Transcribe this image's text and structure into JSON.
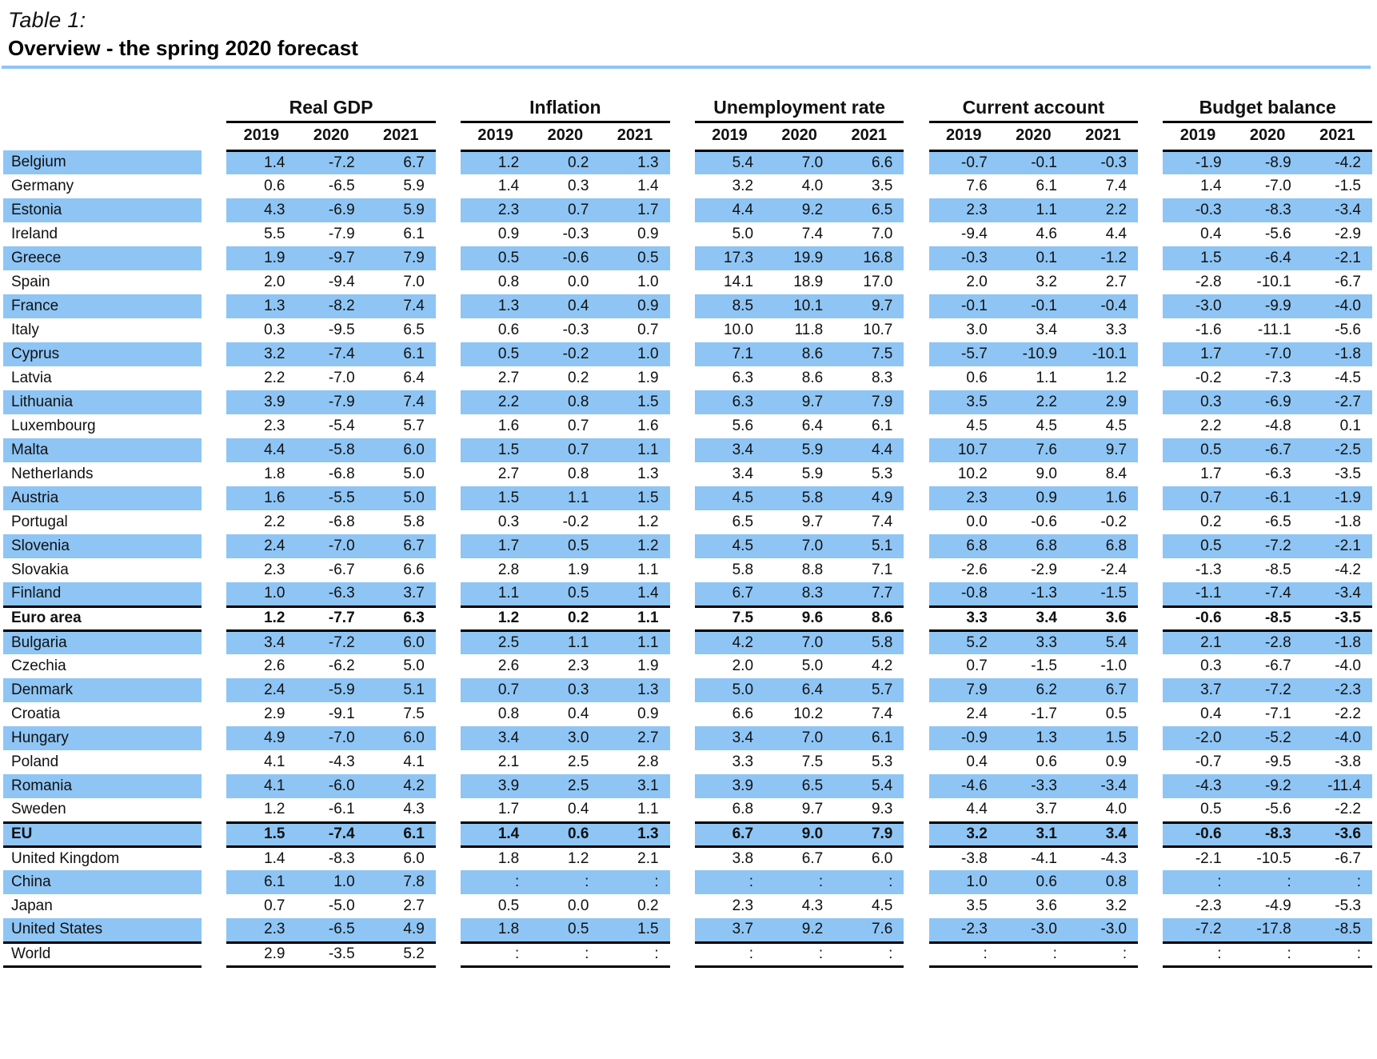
{
  "header": {
    "table_label": "Table 1:",
    "title": "Overview - the spring 2020 forecast",
    "accent_color": "#8EC5F5"
  },
  "columns": {
    "groups": [
      "Real GDP",
      "Inflation",
      "Unemployment rate",
      "Current account",
      "Budget balance"
    ],
    "years": [
      "2019",
      "2020",
      "2021"
    ],
    "missing_symbol": ":"
  },
  "chart_data": {
    "type": "table",
    "title": "Overview - the spring 2020 forecast",
    "column_groups": [
      "Real GDP",
      "Inflation",
      "Unemployment rate",
      "Current account",
      "Budget balance"
    ],
    "years": [
      "2019",
      "2020",
      "2021"
    ],
    "row_labels": [
      "Belgium",
      "Germany",
      "Estonia",
      "Ireland",
      "Greece",
      "Spain",
      "France",
      "Italy",
      "Cyprus",
      "Latvia",
      "Lithuania",
      "Luxembourg",
      "Malta",
      "Netherlands",
      "Austria",
      "Portugal",
      "Slovenia",
      "Slovakia",
      "Finland",
      "Euro area",
      "Bulgaria",
      "Czechia",
      "Denmark",
      "Croatia",
      "Hungary",
      "Poland",
      "Romania",
      "Sweden",
      "EU",
      "United Kingdom",
      "China",
      "Japan",
      "United States",
      "World"
    ]
  },
  "rows": [
    {
      "name": "Belgium",
      "shade": true,
      "agg": false,
      "gdp": [
        "1.4",
        "-7.2",
        "6.7"
      ],
      "inf": [
        "1.2",
        "0.2",
        "1.3"
      ],
      "unemp": [
        "5.4",
        "7.0",
        "6.6"
      ],
      "ca": [
        "-0.7",
        "-0.1",
        "-0.3"
      ],
      "bud": [
        "-1.9",
        "-8.9",
        "-4.2"
      ]
    },
    {
      "name": "Germany",
      "shade": false,
      "agg": false,
      "gdp": [
        "0.6",
        "-6.5",
        "5.9"
      ],
      "inf": [
        "1.4",
        "0.3",
        "1.4"
      ],
      "unemp": [
        "3.2",
        "4.0",
        "3.5"
      ],
      "ca": [
        "7.6",
        "6.1",
        "7.4"
      ],
      "bud": [
        "1.4",
        "-7.0",
        "-1.5"
      ]
    },
    {
      "name": "Estonia",
      "shade": true,
      "agg": false,
      "gdp": [
        "4.3",
        "-6.9",
        "5.9"
      ],
      "inf": [
        "2.3",
        "0.7",
        "1.7"
      ],
      "unemp": [
        "4.4",
        "9.2",
        "6.5"
      ],
      "ca": [
        "2.3",
        "1.1",
        "2.2"
      ],
      "bud": [
        "-0.3",
        "-8.3",
        "-3.4"
      ]
    },
    {
      "name": "Ireland",
      "shade": false,
      "agg": false,
      "gdp": [
        "5.5",
        "-7.9",
        "6.1"
      ],
      "inf": [
        "0.9",
        "-0.3",
        "0.9"
      ],
      "unemp": [
        "5.0",
        "7.4",
        "7.0"
      ],
      "ca": [
        "-9.4",
        "4.6",
        "4.4"
      ],
      "bud": [
        "0.4",
        "-5.6",
        "-2.9"
      ]
    },
    {
      "name": "Greece",
      "shade": true,
      "agg": false,
      "gdp": [
        "1.9",
        "-9.7",
        "7.9"
      ],
      "inf": [
        "0.5",
        "-0.6",
        "0.5"
      ],
      "unemp": [
        "17.3",
        "19.9",
        "16.8"
      ],
      "ca": [
        "-0.3",
        "0.1",
        "-1.2"
      ],
      "bud": [
        "1.5",
        "-6.4",
        "-2.1"
      ]
    },
    {
      "name": "Spain",
      "shade": false,
      "agg": false,
      "gdp": [
        "2.0",
        "-9.4",
        "7.0"
      ],
      "inf": [
        "0.8",
        "0.0",
        "1.0"
      ],
      "unemp": [
        "14.1",
        "18.9",
        "17.0"
      ],
      "ca": [
        "2.0",
        "3.2",
        "2.7"
      ],
      "bud": [
        "-2.8",
        "-10.1",
        "-6.7"
      ]
    },
    {
      "name": "France",
      "shade": true,
      "agg": false,
      "gdp": [
        "1.3",
        "-8.2",
        "7.4"
      ],
      "inf": [
        "1.3",
        "0.4",
        "0.9"
      ],
      "unemp": [
        "8.5",
        "10.1",
        "9.7"
      ],
      "ca": [
        "-0.1",
        "-0.1",
        "-0.4"
      ],
      "bud": [
        "-3.0",
        "-9.9",
        "-4.0"
      ]
    },
    {
      "name": "Italy",
      "shade": false,
      "agg": false,
      "gdp": [
        "0.3",
        "-9.5",
        "6.5"
      ],
      "inf": [
        "0.6",
        "-0.3",
        "0.7"
      ],
      "unemp": [
        "10.0",
        "11.8",
        "10.7"
      ],
      "ca": [
        "3.0",
        "3.4",
        "3.3"
      ],
      "bud": [
        "-1.6",
        "-11.1",
        "-5.6"
      ]
    },
    {
      "name": "Cyprus",
      "shade": true,
      "agg": false,
      "gdp": [
        "3.2",
        "-7.4",
        "6.1"
      ],
      "inf": [
        "0.5",
        "-0.2",
        "1.0"
      ],
      "unemp": [
        "7.1",
        "8.6",
        "7.5"
      ],
      "ca": [
        "-5.7",
        "-10.9",
        "-10.1"
      ],
      "bud": [
        "1.7",
        "-7.0",
        "-1.8"
      ]
    },
    {
      "name": "Latvia",
      "shade": false,
      "agg": false,
      "gdp": [
        "2.2",
        "-7.0",
        "6.4"
      ],
      "inf": [
        "2.7",
        "0.2",
        "1.9"
      ],
      "unemp": [
        "6.3",
        "8.6",
        "8.3"
      ],
      "ca": [
        "0.6",
        "1.1",
        "1.2"
      ],
      "bud": [
        "-0.2",
        "-7.3",
        "-4.5"
      ]
    },
    {
      "name": "Lithuania",
      "shade": true,
      "agg": false,
      "gdp": [
        "3.9",
        "-7.9",
        "7.4"
      ],
      "inf": [
        "2.2",
        "0.8",
        "1.5"
      ],
      "unemp": [
        "6.3",
        "9.7",
        "7.9"
      ],
      "ca": [
        "3.5",
        "2.2",
        "2.9"
      ],
      "bud": [
        "0.3",
        "-6.9",
        "-2.7"
      ]
    },
    {
      "name": "Luxembourg",
      "shade": false,
      "agg": false,
      "gdp": [
        "2.3",
        "-5.4",
        "5.7"
      ],
      "inf": [
        "1.6",
        "0.7",
        "1.6"
      ],
      "unemp": [
        "5.6",
        "6.4",
        "6.1"
      ],
      "ca": [
        "4.5",
        "4.5",
        "4.5"
      ],
      "bud": [
        "2.2",
        "-4.8",
        "0.1"
      ]
    },
    {
      "name": "Malta",
      "shade": true,
      "agg": false,
      "gdp": [
        "4.4",
        "-5.8",
        "6.0"
      ],
      "inf": [
        "1.5",
        "0.7",
        "1.1"
      ],
      "unemp": [
        "3.4",
        "5.9",
        "4.4"
      ],
      "ca": [
        "10.7",
        "7.6",
        "9.7"
      ],
      "bud": [
        "0.5",
        "-6.7",
        "-2.5"
      ]
    },
    {
      "name": "Netherlands",
      "shade": false,
      "agg": false,
      "gdp": [
        "1.8",
        "-6.8",
        "5.0"
      ],
      "inf": [
        "2.7",
        "0.8",
        "1.3"
      ],
      "unemp": [
        "3.4",
        "5.9",
        "5.3"
      ],
      "ca": [
        "10.2",
        "9.0",
        "8.4"
      ],
      "bud": [
        "1.7",
        "-6.3",
        "-3.5"
      ]
    },
    {
      "name": "Austria",
      "shade": true,
      "agg": false,
      "gdp": [
        "1.6",
        "-5.5",
        "5.0"
      ],
      "inf": [
        "1.5",
        "1.1",
        "1.5"
      ],
      "unemp": [
        "4.5",
        "5.8",
        "4.9"
      ],
      "ca": [
        "2.3",
        "0.9",
        "1.6"
      ],
      "bud": [
        "0.7",
        "-6.1",
        "-1.9"
      ]
    },
    {
      "name": "Portugal",
      "shade": false,
      "agg": false,
      "gdp": [
        "2.2",
        "-6.8",
        "5.8"
      ],
      "inf": [
        "0.3",
        "-0.2",
        "1.2"
      ],
      "unemp": [
        "6.5",
        "9.7",
        "7.4"
      ],
      "ca": [
        "0.0",
        "-0.6",
        "-0.2"
      ],
      "bud": [
        "0.2",
        "-6.5",
        "-1.8"
      ]
    },
    {
      "name": "Slovenia",
      "shade": true,
      "agg": false,
      "gdp": [
        "2.4",
        "-7.0",
        "6.7"
      ],
      "inf": [
        "1.7",
        "0.5",
        "1.2"
      ],
      "unemp": [
        "4.5",
        "7.0",
        "5.1"
      ],
      "ca": [
        "6.8",
        "6.8",
        "6.8"
      ],
      "bud": [
        "0.5",
        "-7.2",
        "-2.1"
      ]
    },
    {
      "name": "Slovakia",
      "shade": false,
      "agg": false,
      "gdp": [
        "2.3",
        "-6.7",
        "6.6"
      ],
      "inf": [
        "2.8",
        "1.9",
        "1.1"
      ],
      "unemp": [
        "5.8",
        "8.8",
        "7.1"
      ],
      "ca": [
        "-2.6",
        "-2.9",
        "-2.4"
      ],
      "bud": [
        "-1.3",
        "-8.5",
        "-4.2"
      ]
    },
    {
      "name": "Finland",
      "shade": true,
      "agg": false,
      "gdp": [
        "1.0",
        "-6.3",
        "3.7"
      ],
      "inf": [
        "1.1",
        "0.5",
        "1.4"
      ],
      "unemp": [
        "6.7",
        "8.3",
        "7.7"
      ],
      "ca": [
        "-0.8",
        "-1.3",
        "-1.5"
      ],
      "bud": [
        "-1.1",
        "-7.4",
        "-3.4"
      ]
    },
    {
      "name": "Euro area",
      "shade": false,
      "agg": true,
      "gdp": [
        "1.2",
        "-7.7",
        "6.3"
      ],
      "inf": [
        "1.2",
        "0.2",
        "1.1"
      ],
      "unemp": [
        "7.5",
        "9.6",
        "8.6"
      ],
      "ca": [
        "3.3",
        "3.4",
        "3.6"
      ],
      "bud": [
        "-0.6",
        "-8.5",
        "-3.5"
      ]
    },
    {
      "name": "Bulgaria",
      "shade": true,
      "agg": false,
      "gdp": [
        "3.4",
        "-7.2",
        "6.0"
      ],
      "inf": [
        "2.5",
        "1.1",
        "1.1"
      ],
      "unemp": [
        "4.2",
        "7.0",
        "5.8"
      ],
      "ca": [
        "5.2",
        "3.3",
        "5.4"
      ],
      "bud": [
        "2.1",
        "-2.8",
        "-1.8"
      ]
    },
    {
      "name": "Czechia",
      "shade": false,
      "agg": false,
      "gdp": [
        "2.6",
        "-6.2",
        "5.0"
      ],
      "inf": [
        "2.6",
        "2.3",
        "1.9"
      ],
      "unemp": [
        "2.0",
        "5.0",
        "4.2"
      ],
      "ca": [
        "0.7",
        "-1.5",
        "-1.0"
      ],
      "bud": [
        "0.3",
        "-6.7",
        "-4.0"
      ]
    },
    {
      "name": "Denmark",
      "shade": true,
      "agg": false,
      "gdp": [
        "2.4",
        "-5.9",
        "5.1"
      ],
      "inf": [
        "0.7",
        "0.3",
        "1.3"
      ],
      "unemp": [
        "5.0",
        "6.4",
        "5.7"
      ],
      "ca": [
        "7.9",
        "6.2",
        "6.7"
      ],
      "bud": [
        "3.7",
        "-7.2",
        "-2.3"
      ]
    },
    {
      "name": "Croatia",
      "shade": false,
      "agg": false,
      "gdp": [
        "2.9",
        "-9.1",
        "7.5"
      ],
      "inf": [
        "0.8",
        "0.4",
        "0.9"
      ],
      "unemp": [
        "6.6",
        "10.2",
        "7.4"
      ],
      "ca": [
        "2.4",
        "-1.7",
        "0.5"
      ],
      "bud": [
        "0.4",
        "-7.1",
        "-2.2"
      ]
    },
    {
      "name": "Hungary",
      "shade": true,
      "agg": false,
      "gdp": [
        "4.9",
        "-7.0",
        "6.0"
      ],
      "inf": [
        "3.4",
        "3.0",
        "2.7"
      ],
      "unemp": [
        "3.4",
        "7.0",
        "6.1"
      ],
      "ca": [
        "-0.9",
        "1.3",
        "1.5"
      ],
      "bud": [
        "-2.0",
        "-5.2",
        "-4.0"
      ]
    },
    {
      "name": "Poland",
      "shade": false,
      "agg": false,
      "gdp": [
        "4.1",
        "-4.3",
        "4.1"
      ],
      "inf": [
        "2.1",
        "2.5",
        "2.8"
      ],
      "unemp": [
        "3.3",
        "7.5",
        "5.3"
      ],
      "ca": [
        "0.4",
        "0.6",
        "0.9"
      ],
      "bud": [
        "-0.7",
        "-9.5",
        "-3.8"
      ]
    },
    {
      "name": "Romania",
      "shade": true,
      "agg": false,
      "gdp": [
        "4.1",
        "-6.0",
        "4.2"
      ],
      "inf": [
        "3.9",
        "2.5",
        "3.1"
      ],
      "unemp": [
        "3.9",
        "6.5",
        "5.4"
      ],
      "ca": [
        "-4.6",
        "-3.3",
        "-3.4"
      ],
      "bud": [
        "-4.3",
        "-9.2",
        "-11.4"
      ]
    },
    {
      "name": "Sweden",
      "shade": false,
      "agg": false,
      "gdp": [
        "1.2",
        "-6.1",
        "4.3"
      ],
      "inf": [
        "1.7",
        "0.4",
        "1.1"
      ],
      "unemp": [
        "6.8",
        "9.7",
        "9.3"
      ],
      "ca": [
        "4.4",
        "3.7",
        "4.0"
      ],
      "bud": [
        "0.5",
        "-5.6",
        "-2.2"
      ]
    },
    {
      "name": "EU",
      "shade": true,
      "agg": true,
      "gdp": [
        "1.5",
        "-7.4",
        "6.1"
      ],
      "inf": [
        "1.4",
        "0.6",
        "1.3"
      ],
      "unemp": [
        "6.7",
        "9.0",
        "7.9"
      ],
      "ca": [
        "3.2",
        "3.1",
        "3.4"
      ],
      "bud": [
        "-0.6",
        "-8.3",
        "-3.6"
      ]
    },
    {
      "name": "United Kingdom",
      "shade": false,
      "agg": false,
      "gdp": [
        "1.4",
        "-8.3",
        "6.0"
      ],
      "inf": [
        "1.8",
        "1.2",
        "2.1"
      ],
      "unemp": [
        "3.8",
        "6.7",
        "6.0"
      ],
      "ca": [
        "-3.8",
        "-4.1",
        "-4.3"
      ],
      "bud": [
        "-2.1",
        "-10.5",
        "-6.7"
      ]
    },
    {
      "name": "China",
      "shade": true,
      "agg": false,
      "gdp": [
        "6.1",
        "1.0",
        "7.8"
      ],
      "inf": [
        ":",
        ":",
        ":"
      ],
      "unemp": [
        ":",
        ":",
        ":"
      ],
      "ca": [
        "1.0",
        "0.6",
        "0.8"
      ],
      "bud": [
        ":",
        ":",
        ":"
      ]
    },
    {
      "name": "Japan",
      "shade": false,
      "agg": false,
      "gdp": [
        "0.7",
        "-5.0",
        "2.7"
      ],
      "inf": [
        "0.5",
        "0.0",
        "0.2"
      ],
      "unemp": [
        "2.3",
        "4.3",
        "4.5"
      ],
      "ca": [
        "3.5",
        "3.6",
        "3.2"
      ],
      "bud": [
        "-2.3",
        "-4.9",
        "-5.3"
      ]
    },
    {
      "name": "United States",
      "shade": true,
      "agg": false,
      "gdp": [
        "2.3",
        "-6.5",
        "4.9"
      ],
      "inf": [
        "1.8",
        "0.5",
        "1.5"
      ],
      "unemp": [
        "3.7",
        "9.2",
        "7.6"
      ],
      "ca": [
        "-2.3",
        "-3.0",
        "-3.0"
      ],
      "bud": [
        "-7.2",
        "-17.8",
        "-8.5"
      ]
    },
    {
      "name": "World",
      "shade": false,
      "agg": false,
      "toprule": true,
      "lastrow": true,
      "gdp": [
        "2.9",
        "-3.5",
        "5.2"
      ],
      "inf": [
        ":",
        ":",
        ":"
      ],
      "unemp": [
        ":",
        ":",
        ":"
      ],
      "ca": [
        ":",
        ":",
        ":"
      ],
      "bud": [
        ":",
        ":",
        ":"
      ]
    }
  ]
}
